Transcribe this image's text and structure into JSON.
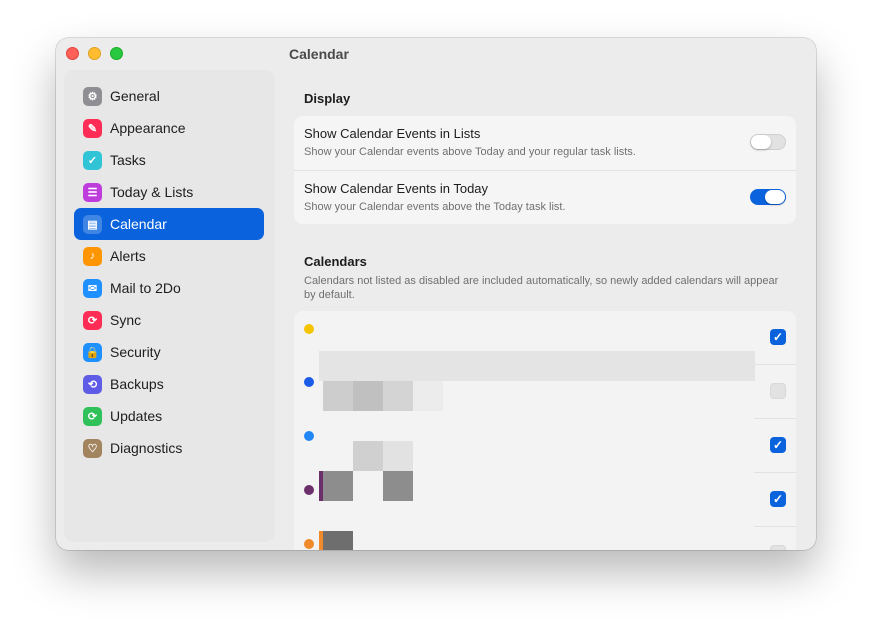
{
  "window": {
    "title": "Calendar"
  },
  "sidebar": {
    "items": [
      {
        "label": "General",
        "icon": "gear-icon",
        "color": "#8e8e93",
        "glyph": "⚙",
        "active": false
      },
      {
        "label": "Appearance",
        "icon": "paintbrush-icon",
        "color": "#ff2d55",
        "glyph": "✎",
        "active": false
      },
      {
        "label": "Tasks",
        "icon": "checkmark-circle-icon",
        "color": "#30c4d6",
        "glyph": "✓",
        "active": false
      },
      {
        "label": "Today & Lists",
        "icon": "list-icon",
        "color": "#bf3cdc",
        "glyph": "☰",
        "active": false
      },
      {
        "label": "Calendar",
        "icon": "calendar-icon",
        "color": "#0a63dd",
        "glyph": "▤",
        "active": true
      },
      {
        "label": "Alerts",
        "icon": "bell-icon",
        "color": "#ff9500",
        "glyph": "♪",
        "active": false
      },
      {
        "label": "Mail to 2Do",
        "icon": "envelope-icon",
        "color": "#1e90ff",
        "glyph": "✉",
        "active": false
      },
      {
        "label": "Sync",
        "icon": "sync-icon",
        "color": "#ff2d55",
        "glyph": "⟳",
        "active": false
      },
      {
        "label": "Security",
        "icon": "lock-icon",
        "color": "#1e90ff",
        "glyph": "🔒",
        "active": false
      },
      {
        "label": "Backups",
        "icon": "clock-history-icon",
        "color": "#5e5ce6",
        "glyph": "⟲",
        "active": false
      },
      {
        "label": "Updates",
        "icon": "refresh-icon",
        "color": "#30c15a",
        "glyph": "⟳",
        "active": false
      },
      {
        "label": "Diagnostics",
        "icon": "stethoscope-icon",
        "color": "#a2845e",
        "glyph": "♡",
        "active": false
      }
    ]
  },
  "display": {
    "title": "Display",
    "rows": [
      {
        "title": "Show Calendar Events in Lists",
        "subtitle": "Show your Calendar events above Today and your regular task lists.",
        "enabled": false
      },
      {
        "title": "Show Calendar Events in Today",
        "subtitle": "Show your Calendar events above the Today task list.",
        "enabled": true
      }
    ]
  },
  "calendars": {
    "title": "Calendars",
    "description": "Calendars not listed as disabled are included automatically, so newly added calendars will appear by default.",
    "rows": [
      {
        "color": "#f5c400",
        "checked": true
      },
      {
        "color": "#1a5ce8",
        "checked": false
      },
      {
        "color": "#2286f5",
        "checked": true
      },
      {
        "color": "#6b2f6b",
        "checked": true
      },
      {
        "color": "#f0892a",
        "checked": false
      }
    ]
  }
}
